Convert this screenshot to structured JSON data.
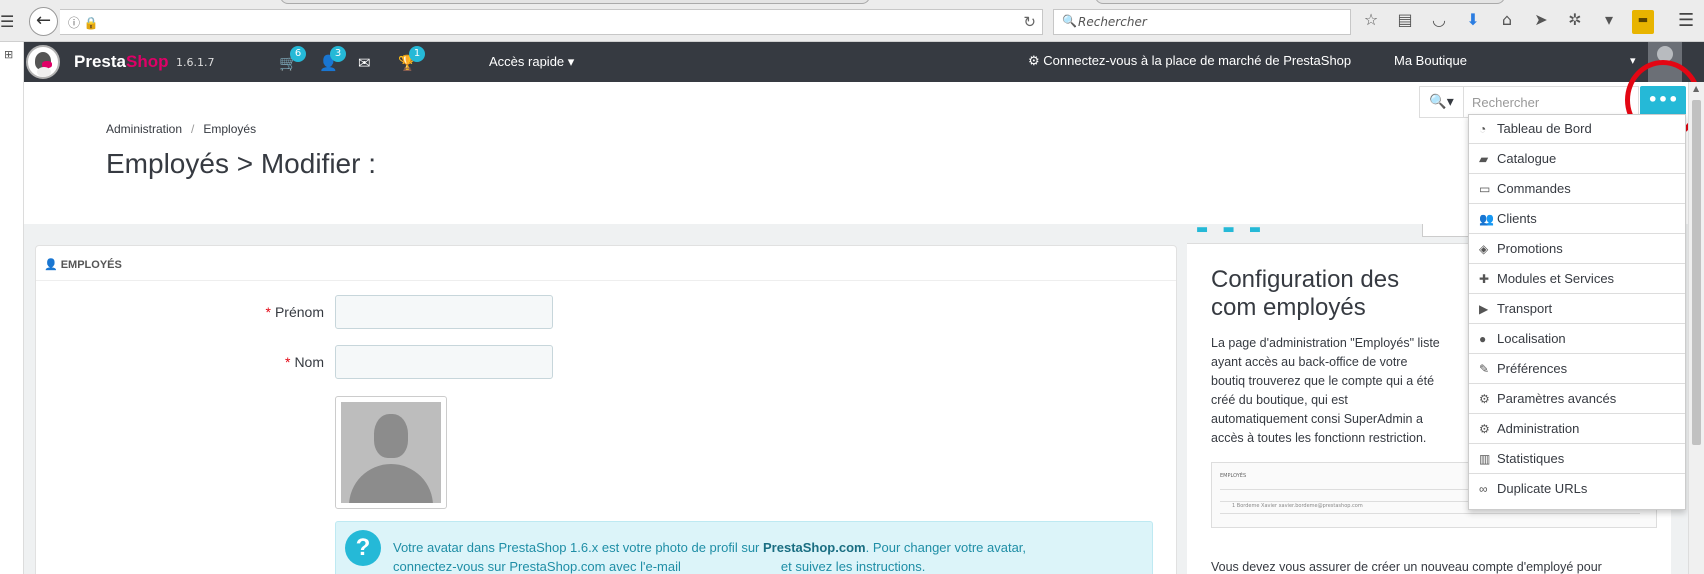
{
  "browser": {
    "search_placeholder": "Rechercher"
  },
  "header": {
    "brand_part1": "Presta",
    "brand_part2": "Shop",
    "version": "1.6.1.7",
    "notifications": {
      "orders_count": "6",
      "customers_count": "3",
      "messages_count": "",
      "trophy_count": "1"
    },
    "quick_access": "Accès rapide",
    "marketplace": "Connectez-vous à la place de marché de PrestaShop",
    "shop": "Ma Boutique"
  },
  "page": {
    "breadcrumb": [
      "Administration",
      "Employés"
    ],
    "breadcrumb_sep": "/",
    "title": "Employés > Modifier :",
    "search_placeholder": "Rechercher",
    "menu_toggle": "•••"
  },
  "form": {
    "panel_title": "EMPLOYÉS",
    "firstname_label": "Prénom",
    "lastname_label": "Nom",
    "required_mark": "*",
    "info_prefix": "Votre avatar dans PrestaShop 1.6.x est votre photo de profil sur ",
    "info_brand": "PrestaShop.com",
    "info_suffix": ". Pour changer votre avatar,",
    "info_line2a": "connectez-vous sur PrestaShop.com avec l'e-mail",
    "info_line2b": "et suivez les instructions."
  },
  "help": {
    "title": "Configuration des com employés",
    "body": "La page d'administration \"Employés\" liste ayant accès au back-office de votre boutiq trouverez que le compte qui a été créé du boutique, qui est automatiquement consi SuperAdmin a accès à toutes les fonctionn restriction.",
    "thumb_header": "EMPLOYÉS",
    "thumb_row": "1   Bordeme   Xavier   xavier.bordeme@prestashop.com",
    "footer": "Vous devez vous assurer de créer un nouveau compte d'employé pour"
  },
  "menu": {
    "items": [
      {
        "label": "Tableau de Bord",
        "icon": "dashboard-icon"
      },
      {
        "label": "Catalogue",
        "icon": "book-icon"
      },
      {
        "label": "Commandes",
        "icon": "credit-card-icon"
      },
      {
        "label": "Clients",
        "icon": "users-icon"
      },
      {
        "label": "Promotions",
        "icon": "tags-icon"
      },
      {
        "label": "Modules et Services",
        "icon": "puzzle-icon"
      },
      {
        "label": "Transport",
        "icon": "truck-icon"
      },
      {
        "label": "Localisation",
        "icon": "globe-icon"
      },
      {
        "label": "Préférences",
        "icon": "wrench-icon"
      },
      {
        "label": "Paramètres avancés",
        "icon": "cogs-icon"
      },
      {
        "label": "Administration",
        "icon": "cog-icon"
      },
      {
        "label": "Statistiques",
        "icon": "bar-chart-icon"
      },
      {
        "label": "Duplicate URLs",
        "icon": "link-icon"
      }
    ]
  },
  "colors": {
    "header_bg": "#363a41",
    "accent": "#25b9d7",
    "brand_pink": "#df0067",
    "annotation_red": "#e30613"
  }
}
